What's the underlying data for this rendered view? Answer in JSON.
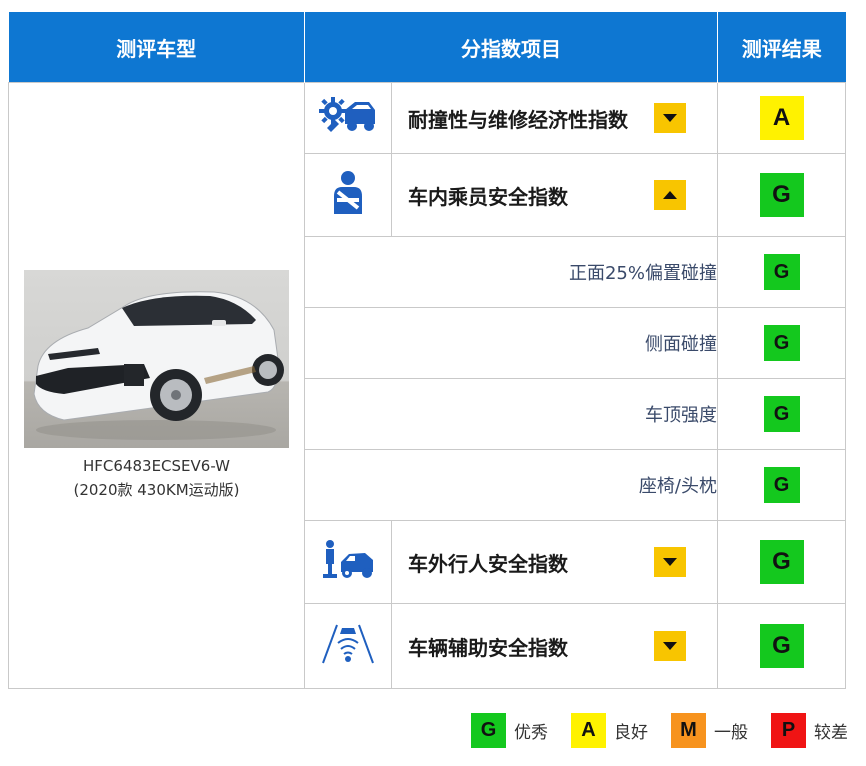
{
  "header": {
    "col_model": "测评车型",
    "col_index": "分指数项目",
    "col_result": "测评结果"
  },
  "car": {
    "model_code": "HFC6483ECSEV6-W",
    "edition": "(2020款 430KM运动版)"
  },
  "rows": {
    "r1": {
      "label": "耐撞性与维修经济性指数",
      "result": "A",
      "icon": "car-repair-gear-icon",
      "toggle": "collapsed"
    },
    "r2": {
      "label": "车内乘员安全指数",
      "result": "G",
      "icon": "seatbelt-occupant-icon",
      "toggle": "expanded"
    },
    "r2_1": {
      "label": "正面25%偏置碰撞",
      "result": "G"
    },
    "r2_2": {
      "label": "侧面碰撞",
      "result": "G"
    },
    "r2_3": {
      "label": "车顶强度",
      "result": "G"
    },
    "r2_4": {
      "label": "座椅/头枕",
      "result": "G"
    },
    "r3": {
      "label": "车外行人安全指数",
      "result": "G",
      "icon": "pedestrian-car-icon",
      "toggle": "collapsed"
    },
    "r4": {
      "label": "车辆辅助安全指数",
      "result": "G",
      "icon": "driver-assist-lane-icon",
      "toggle": "collapsed"
    }
  },
  "legend": {
    "g": {
      "letter": "G",
      "label": "优秀"
    },
    "a": {
      "letter": "A",
      "label": "良好"
    },
    "m": {
      "letter": "M",
      "label": "一般"
    },
    "p": {
      "letter": "P",
      "label": "较差"
    }
  },
  "colors": {
    "header_bg": "#0e77d2",
    "icon_blue": "#1f5fbf",
    "rating_G": "#14c81e",
    "rating_A": "#fff200",
    "rating_M": "#f7931e",
    "rating_P": "#f01414",
    "toggle": "#f8c500"
  }
}
